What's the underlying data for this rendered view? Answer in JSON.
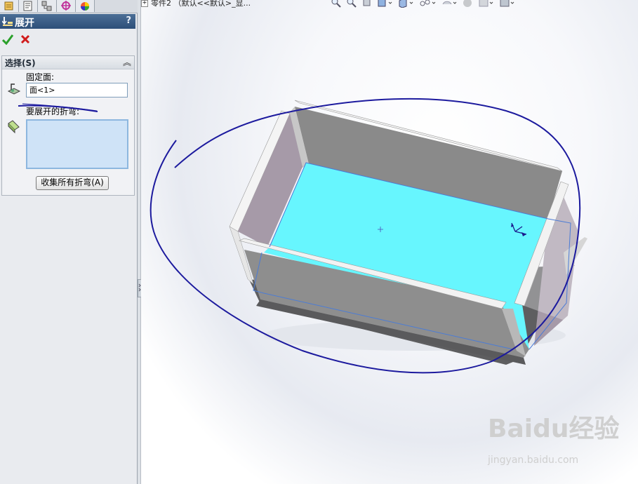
{
  "panel": {
    "title": "展开",
    "help": "?",
    "group_title": "选择(S)",
    "fixed_face_label": "固定面:",
    "fixed_face_value": "面<1>",
    "bends_label": "要展开的折弯:",
    "collect_button": "收集所有折弯(A)"
  },
  "document": {
    "title": "零件2 （默认<<默认>_显..."
  },
  "watermark": {
    "brand": "Baidu经验",
    "url": "jingyan.baidu.com"
  },
  "colors": {
    "header": "#3a5c86",
    "face_selected": "#67f6fe",
    "wall": "#8d8d8d",
    "annotation": "#1c1a9e"
  }
}
